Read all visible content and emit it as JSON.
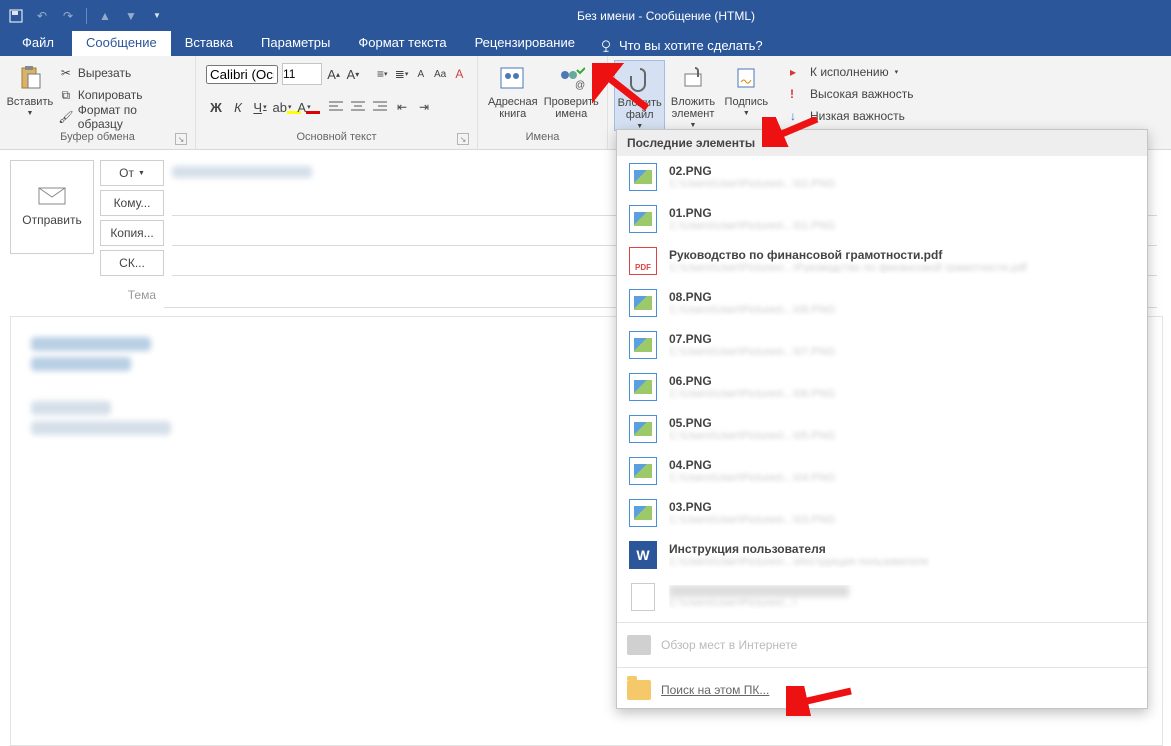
{
  "window": {
    "title": "Без имени - Сообщение (HTML)"
  },
  "tabs": {
    "file": "Файл",
    "message": "Сообщение",
    "insert": "Вставка",
    "options": "Параметры",
    "format": "Формат текста",
    "review": "Рецензирование",
    "tell": "Что вы хотите сделать?"
  },
  "ribbon": {
    "paste": "Вставить",
    "cut": "Вырезать",
    "copy": "Копировать",
    "painter": "Формат по образцу",
    "clipboard_label": "Буфер обмена",
    "font_name": "Calibri (Основной текст)",
    "font_size": "11",
    "font_label": "Основной текст",
    "addrbook": "Адресная книга",
    "checknames": "Проверить имена",
    "names_label": "Имена",
    "attach_file": "Вложить файл",
    "attach_item": "Вложить элемент",
    "signature": "Подпись",
    "followup": "К исполнению",
    "high_imp": "Высокая важность",
    "low_imp": "Низкая важность"
  },
  "compose": {
    "send": "Отправить",
    "from": "От",
    "to": "Кому...",
    "cc": "Копия...",
    "bcc": "СК...",
    "subject": "Тема"
  },
  "menu": {
    "header": "Последние элементы",
    "items": [
      {
        "icon": "img",
        "name": "02.PNG"
      },
      {
        "icon": "img",
        "name": "01.PNG"
      },
      {
        "icon": "pdf",
        "name": "Руководство по финансовой грамотности.pdf"
      },
      {
        "icon": "img",
        "name": "08.PNG"
      },
      {
        "icon": "img",
        "name": "07.PNG"
      },
      {
        "icon": "img",
        "name": "06.PNG"
      },
      {
        "icon": "img",
        "name": "05.PNG"
      },
      {
        "icon": "img",
        "name": "04.PNG"
      },
      {
        "icon": "img",
        "name": "03.PNG"
      },
      {
        "icon": "doc",
        "name": "Инструкция пользователя"
      },
      {
        "icon": "blank",
        "name": ""
      }
    ],
    "browse_web": "Обзор мест в Интернете",
    "browse_pc": "Поиск на этом ПК..."
  }
}
